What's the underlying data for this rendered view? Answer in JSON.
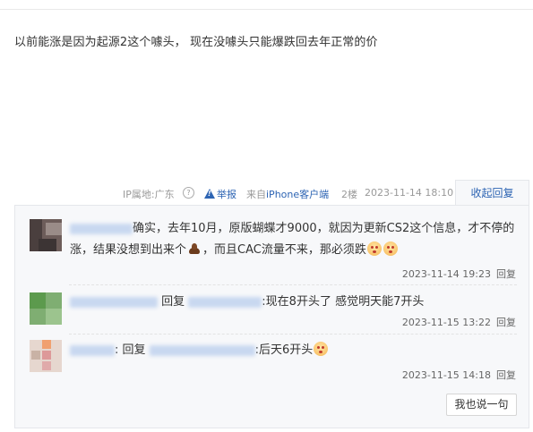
{
  "post": {
    "content": "以前能涨是因为起源2这个噱头， 现在没噱头只能爆跌回去年正常的价"
  },
  "tail": {
    "ip_location": "IP属地:广东",
    "help_glyph": "?",
    "report": "举报",
    "from_prefix": "来自",
    "device": "iPhone客户端",
    "floor": "2楼",
    "time": "2023-11-14 18:10",
    "collapse_reply": "收起回复"
  },
  "replies": [
    {
      "text_part1": "确实，去年10月，原版蝴蝶才9000，就因为更新CS2这个信息，才不停的涨，结果没想到出来个",
      "text_part2": "，而且CAC流量不来，那必须跌",
      "time": "2023-11-14 19:23",
      "reply_label": "回复"
    },
    {
      "reply_word": "回复",
      "text": ":现在8开头了 感觉明天能7开头",
      "time": "2023-11-15 13:22",
      "reply_label": "回复"
    },
    {
      "reply_word": ": 回复",
      "text": ":后天6开头",
      "time": "2023-11-15 14:18",
      "reply_label": "回复"
    }
  ],
  "say_button": "我也说一句"
}
